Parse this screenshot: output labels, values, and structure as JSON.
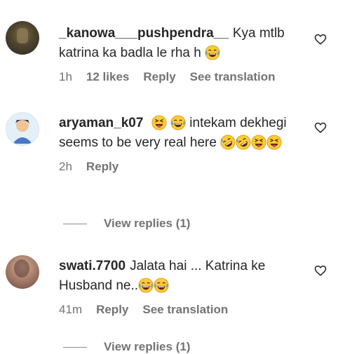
{
  "comments": [
    {
      "username": "_kanowa___pushpendra__",
      "text": "Kya mtlb katrina ka badla le rha h",
      "time": "1h",
      "likes": "12 likes",
      "reply": "Reply",
      "translation": "See translation"
    },
    {
      "username": "aryaman_k07",
      "text": "intekam dekhegi seems to be very real here",
      "time": "2h",
      "reply": "Reply",
      "view_replies": "View replies (1)"
    },
    {
      "username": "swati.7700",
      "text": "Jalata hai ... Katrina ke Husband ne..",
      "time": "41m",
      "reply": "Reply",
      "translation": "See translation",
      "view_replies": "View replies (1)"
    }
  ],
  "icons": {
    "heart": "heart-outline-icon",
    "laugh": "face-with-tears-of-joy-icon",
    "rofl": "rolling-on-floor-laughing-icon",
    "squint_tongue": "squinting-face-with-tongue-icon"
  }
}
